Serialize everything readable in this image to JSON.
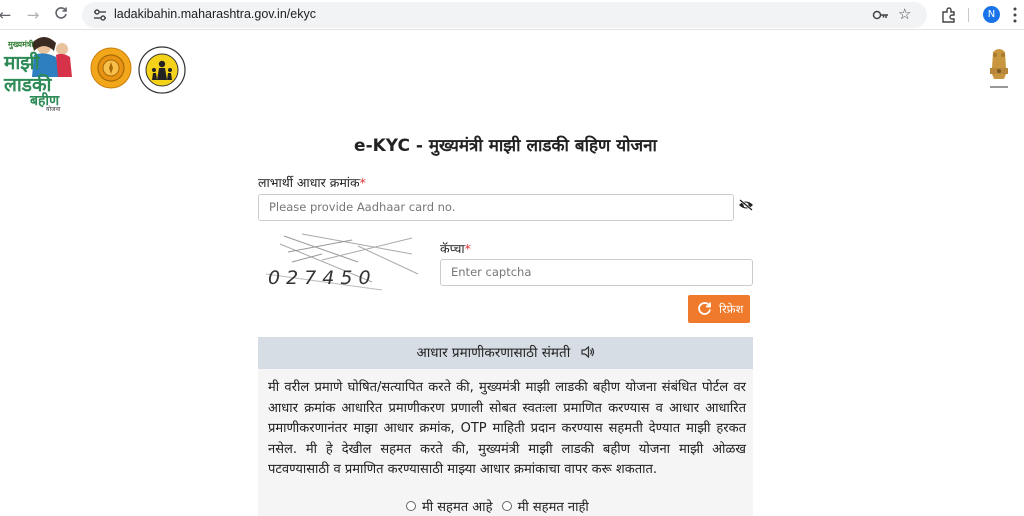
{
  "browser": {
    "url": "ladakibahin.maharashtra.gov.in/ekyc",
    "profile_initial": "N"
  },
  "header": {
    "logo_text": "मुख्यमंत्री माझी लाडकी बहीण योजना"
  },
  "form": {
    "title": "e-KYC - मुख्यमंत्री माझी लाडकी बहिण योजना",
    "aadhaar_label": "लाभार्थी आधार क्रमांक",
    "aadhaar_placeholder": "Please provide Aadhaar card no.",
    "captcha_label": "कॅप्चा",
    "captcha_value": "027450",
    "captcha_placeholder": "Enter captcha",
    "refresh_label": "रिफ्रेश",
    "required_mark": "*"
  },
  "consent": {
    "heading": "आधार प्रमाणीकरणासाठी संमती",
    "text": "मी वरील प्रमाणे घोषित/सत्यापित करते की, मुख्यमंत्री माझी लाडकी बहीण योजना संबंधित पोर्टल वर आधार क्रमांक आधारित प्रमाणीकरण प्रणाली सोबत स्वतःला प्रमाणित करण्यास व आधार आधारित प्रमाणीकरणानंतर माझा आधार क्रमांक, OTP माहिती प्रदान करण्यास सहमती देण्यात माझी हरकत नसेल. मी हे देखील सहमत करते की, मुख्यमंत्री माझी लाडकी बहीण योजना माझी ओळख पटवण्यासाठी व प्रमाणित करण्यासाठी माझ्या आधार क्रमांकाचा वापर करू शकतात.",
    "agree_label": "मी सहमत आहे",
    "disagree_label": "मी सहमत नाही"
  },
  "colors": {
    "accent": "#f07a2b",
    "consent_header_bg": "#d7dde4",
    "consent_body_bg": "#f5f5f5"
  }
}
